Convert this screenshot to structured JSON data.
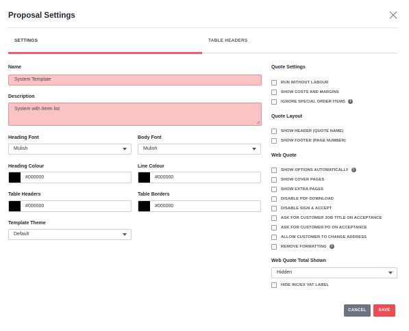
{
  "modal": {
    "title": "Proposal Settings"
  },
  "tabs": [
    {
      "label": "SETTINGS",
      "active": true
    },
    {
      "label": "TABLE HEADERS",
      "active": false
    }
  ],
  "form": {
    "name": {
      "label": "Name",
      "value": "System Template"
    },
    "description": {
      "label": "Description",
      "value": "System with Iterm list"
    },
    "heading_font": {
      "label": "Heading Font",
      "value": "Mulish"
    },
    "body_font": {
      "label": "Body Font",
      "value": "Mulish"
    },
    "heading_colour": {
      "label": "Heading Colour",
      "value": "#000000"
    },
    "line_colour": {
      "label": "Line Colour",
      "value": "#000000"
    },
    "table_headers": {
      "label": "Table Headers",
      "value": "#000000"
    },
    "table_borders": {
      "label": "Table Borders",
      "value": "#000000"
    },
    "template_theme": {
      "label": "Template Theme",
      "value": "Default"
    }
  },
  "quote_settings": {
    "title": "Quote Settings",
    "items": [
      {
        "label": "RUN WITHOUT LABOUR",
        "checked": false
      },
      {
        "label": "SHOW COSTS AND MARGINS",
        "checked": false
      },
      {
        "label": "IGNORE SPECIAL ORDER ITEMS",
        "checked": false
      }
    ]
  },
  "quote_layout": {
    "title": "Quote Layout",
    "items": [
      {
        "label": "SHOW HEADER (QUOTE NAME)",
        "checked": false
      },
      {
        "label": "SHOW FOOTER (PAGE NUMBER)",
        "checked": false
      }
    ]
  },
  "web_quote": {
    "title": "Web Quote",
    "items": [
      {
        "label": "SHOW OPTIONS AUTOMATICALLY",
        "checked": false
      },
      {
        "label": "SHOW COVER PAGES",
        "checked": false
      },
      {
        "label": "SHOW EXTRA PAGES",
        "checked": false
      },
      {
        "label": "DISABLE PDF DOWNLOAD",
        "checked": false
      },
      {
        "label": "DISABLE SIGN & ACCEPT",
        "checked": false
      },
      {
        "label": "ASK FOR CUSTOMER JOB TITLE ON ACCEPTANCE",
        "checked": false
      },
      {
        "label": "ASK FOR CUSTOMER PO ON ACCEPTANCE",
        "checked": false
      },
      {
        "label": "ALLOW CUSTOMER TO CHANGE ADDRESS",
        "checked": false
      },
      {
        "label": "REMOVE FORMATTING",
        "checked": false
      }
    ]
  },
  "web_quote_total": {
    "title": "Web Quote Total Shown",
    "value": "Hidden",
    "hide_label": {
      "label": "HIDE INC/EX VAT LABEL",
      "checked": false
    }
  },
  "buttons": {
    "cancel": "CANCEL",
    "save": "SAVE"
  },
  "colors": {
    "accent": "#e85f6e",
    "error_bg": "#fcc3c5",
    "save": "#ef4b55",
    "cancel": "#6b7280"
  },
  "icons": {
    "close": "close-icon",
    "info": "info-icon",
    "dropdown": "chevron-down-icon"
  }
}
